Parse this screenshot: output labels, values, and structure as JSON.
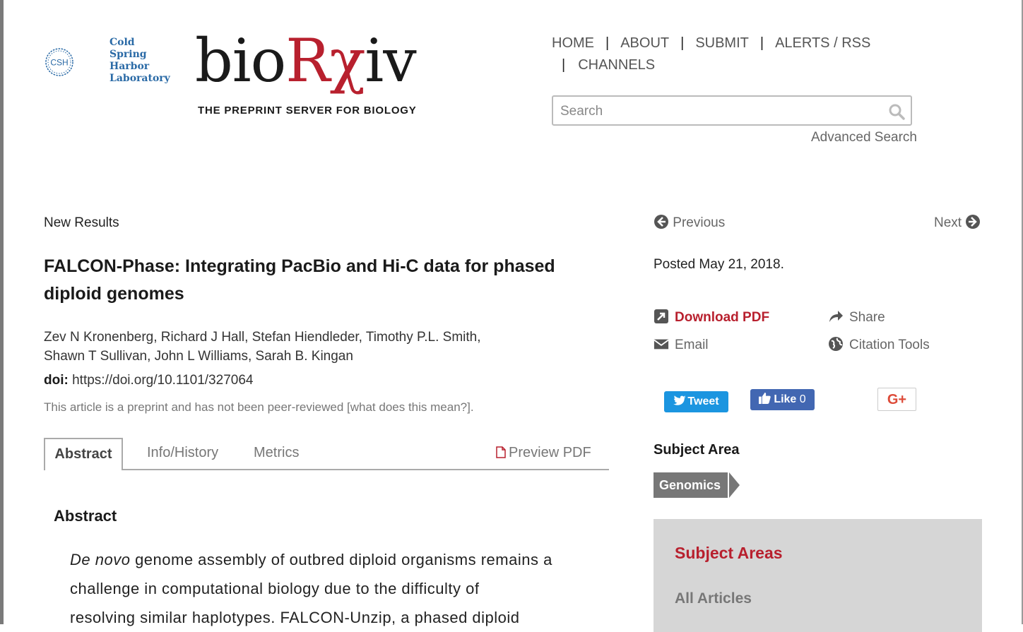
{
  "header": {
    "csh_lines": [
      "Cold",
      "Spring",
      "Harbor",
      "Laboratory"
    ],
    "csh_badge": "CSH",
    "brand_prefix": "bio",
    "brand_rx": "Rχ",
    "brand_suffix": "iv",
    "tagline": "THE PREPRINT SERVER FOR BIOLOGY"
  },
  "nav": {
    "items": [
      "HOME",
      "ABOUT",
      "SUBMIT",
      "ALERTS / RSS",
      "CHANNELS"
    ],
    "separator": "|"
  },
  "search": {
    "placeholder": "Search",
    "advanced": "Advanced Search"
  },
  "article": {
    "type": "New Results",
    "title": "FALCON-Phase: Integrating PacBio and Hi-C data for phased diploid genomes",
    "authors_line1": "Zev N Kronenberg, Richard J Hall, Stefan Hiendleder, Timothy P.L. Smith,",
    "authors_line2": "Shawn T Sullivan, John L Williams, Sarah B. Kingan",
    "doi_label": "doi:",
    "doi_value": "https://doi.org/10.1101/327064",
    "notice": "This article is a preprint and has not been peer-reviewed [what does this mean?]."
  },
  "tabs": {
    "abstract": "Abstract",
    "info": "Info/History",
    "metrics": "Metrics",
    "preview": "Preview PDF"
  },
  "abstract": {
    "heading": "Abstract",
    "italic": "De novo",
    "text_line1": " genome assembly of outbred diploid organisms remains a",
    "text_line2": "challenge in computational biology due to the difficulty of",
    "text_line3": "resolving similar haplotypes. FALCON-Unzip, a phased diploid"
  },
  "sidebar": {
    "previous": "Previous",
    "next": "Next",
    "posted": "Posted May 21, 2018.",
    "download": "Download PDF",
    "share": "Share",
    "email": "Email",
    "citation": "Citation Tools",
    "tweet": "Tweet",
    "like": "Like",
    "like_count": "0",
    "gplus": "G+",
    "subject_label": "Subject Area",
    "subject_tag": "Genomics",
    "panel_title": "Subject Areas",
    "panel_all": "All Articles"
  },
  "colors": {
    "brand_red": "#b8202e",
    "csh_blue": "#2a6aa6",
    "twitter": "#1b95e0",
    "facebook": "#4267b2"
  }
}
